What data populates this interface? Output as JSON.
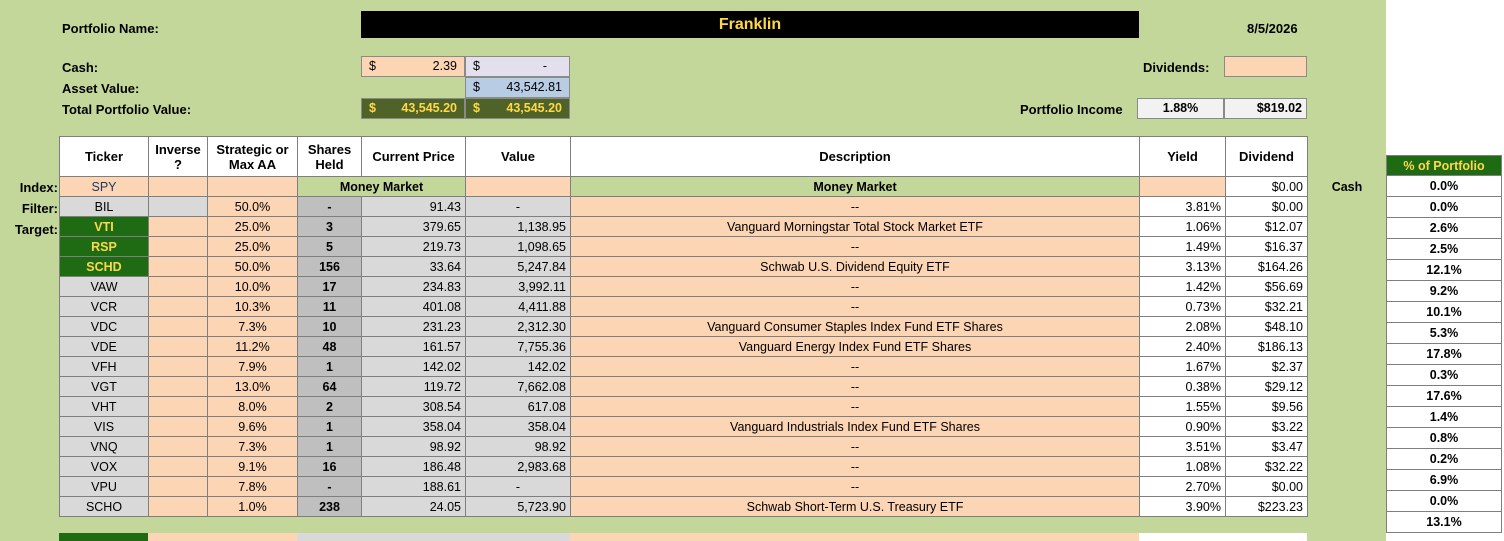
{
  "header": {
    "portfolio_name_label": "Portfolio Name:",
    "portfolio_name": "Franklin",
    "date": "8/5/2026",
    "cash_label": "Cash:",
    "asset_value_label": "Asset Value:",
    "total_label": "Total Portfolio Value:",
    "dividends_label": "Dividends:",
    "income_label": "Portfolio Income",
    "currency_symbol": "$",
    "cash_value": "2.39",
    "cash_value2": "-",
    "asset_value": "43,542.81",
    "total_value": "43,545.20",
    "total_value2": "43,545.20",
    "income_yield": "1.88%",
    "income_amount": "$819.02"
  },
  "row_labels": {
    "index": "Index:",
    "filter": "Filter:",
    "target": "Target:"
  },
  "columns": {
    "ticker": "Ticker",
    "inverse": "Inverse ?",
    "strategic": "Strategic or Max AA",
    "shares": "Shares Held",
    "price": "Current Price",
    "value": "Value",
    "description": "Description",
    "yield": "Yield",
    "dividend": "Dividend",
    "pct": "% of Portfolio"
  },
  "index_row": {
    "ticker": "SPY",
    "money_market_1": "Money Market",
    "money_market_2": "Money Market",
    "dividend": "$0.00",
    "cash": "Cash",
    "pct": "0.0%"
  },
  "rows": [
    {
      "ticker": "BIL",
      "aa": "50.0%",
      "shares": "-",
      "price": "91.43",
      "value": "-",
      "desc": "--",
      "yield": "3.81%",
      "div": "$0.00",
      "pct": "0.0%"
    },
    {
      "ticker": "VTI",
      "aa": "25.0%",
      "shares": "3",
      "price": "379.65",
      "value": "1,138.95",
      "desc": "Vanguard Morningstar Total Stock Market ETF",
      "yield": "1.06%",
      "div": "$12.07",
      "pct": "2.6%"
    },
    {
      "ticker": "RSP",
      "aa": "25.0%",
      "shares": "5",
      "price": "219.73",
      "value": "1,098.65",
      "desc": "--",
      "yield": "1.49%",
      "div": "$16.37",
      "pct": "2.5%"
    },
    {
      "ticker": "SCHD",
      "aa": "50.0%",
      "shares": "156",
      "price": "33.64",
      "value": "5,247.84",
      "desc": "Schwab U.S. Dividend Equity ETF",
      "yield": "3.13%",
      "div": "$164.26",
      "pct": "12.1%"
    },
    {
      "ticker": "VAW",
      "aa": "10.0%",
      "shares": "17",
      "price": "234.83",
      "value": "3,992.11",
      "desc": "--",
      "yield": "1.42%",
      "div": "$56.69",
      "pct": "9.2%"
    },
    {
      "ticker": "VCR",
      "aa": "10.3%",
      "shares": "11",
      "price": "401.08",
      "value": "4,411.88",
      "desc": "--",
      "yield": "0.73%",
      "div": "$32.21",
      "pct": "10.1%"
    },
    {
      "ticker": "VDC",
      "aa": "7.3%",
      "shares": "10",
      "price": "231.23",
      "value": "2,312.30",
      "desc": "Vanguard Consumer Staples Index Fund ETF Shares",
      "yield": "2.08%",
      "div": "$48.10",
      "pct": "5.3%"
    },
    {
      "ticker": "VDE",
      "aa": "11.2%",
      "shares": "48",
      "price": "161.57",
      "value": "7,755.36",
      "desc": "Vanguard Energy Index Fund ETF Shares",
      "yield": "2.40%",
      "div": "$186.13",
      "pct": "17.8%"
    },
    {
      "ticker": "VFH",
      "aa": "7.9%",
      "shares": "1",
      "price": "142.02",
      "value": "142.02",
      "desc": "--",
      "yield": "1.67%",
      "div": "$2.37",
      "pct": "0.3%"
    },
    {
      "ticker": "VGT",
      "aa": "13.0%",
      "shares": "64",
      "price": "119.72",
      "value": "7,662.08",
      "desc": "--",
      "yield": "0.38%",
      "div": "$29.12",
      "pct": "17.6%"
    },
    {
      "ticker": "VHT",
      "aa": "8.0%",
      "shares": "2",
      "price": "308.54",
      "value": "617.08",
      "desc": "--",
      "yield": "1.55%",
      "div": "$9.56",
      "pct": "1.4%"
    },
    {
      "ticker": "VIS",
      "aa": "9.6%",
      "shares": "1",
      "price": "358.04",
      "value": "358.04",
      "desc": "Vanguard Industrials Index Fund ETF Shares",
      "yield": "0.90%",
      "div": "$3.22",
      "pct": "0.8%"
    },
    {
      "ticker": "VNQ",
      "aa": "7.3%",
      "shares": "1",
      "price": "98.92",
      "value": "98.92",
      "desc": "--",
      "yield": "3.51%",
      "div": "$3.47",
      "pct": "0.2%"
    },
    {
      "ticker": "VOX",
      "aa": "9.1%",
      "shares": "16",
      "price": "186.48",
      "value": "2,983.68",
      "desc": "--",
      "yield": "1.08%",
      "div": "$32.22",
      "pct": "6.9%"
    },
    {
      "ticker": "VPU",
      "aa": "7.8%",
      "shares": "-",
      "price": "188.61",
      "value": "-",
      "desc": "--",
      "yield": "2.70%",
      "div": "$0.00",
      "pct": "0.0%"
    },
    {
      "ticker": "SCHO",
      "aa": "1.0%",
      "shares": "238",
      "price": "24.05",
      "value": "5,723.90",
      "desc": "Schwab Short-Term U.S. Treasury ETF",
      "yield": "3.90%",
      "div": "$223.23",
      "pct": "13.1%"
    }
  ],
  "colors": {
    "sheet_bg": "#c4d79b",
    "orange_cell": "#fcd5b4",
    "grey_cell": "#d9d9d9",
    "green_ticker": "#1e6b14",
    "gold_text": "#ffd84a"
  }
}
